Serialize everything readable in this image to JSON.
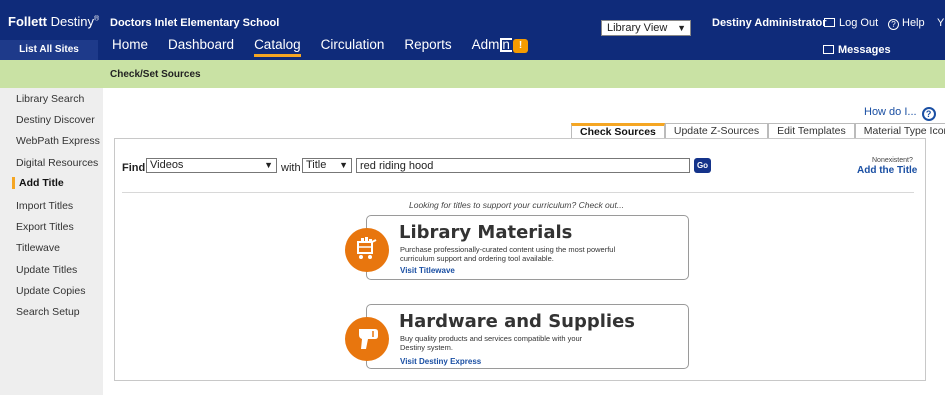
{
  "header": {
    "logo_bold": "Follett",
    "logo_light": "Destiny",
    "logo_mark": "®",
    "school_name": "Doctors Inlet Elementary School",
    "list_all_sites": "List All Sites",
    "view_select": "Library View",
    "user": "Destiny Administrator",
    "logout": "Log Out",
    "help": "Help",
    "help_overflow": "Y",
    "messages": "Messages",
    "alert_badge": "!",
    "nav": [
      {
        "label": "Home"
      },
      {
        "label": "Dashboard"
      },
      {
        "label": "Catalog",
        "active": true
      },
      {
        "label": "Circulation"
      },
      {
        "label": "Reports"
      },
      {
        "label": "Admin"
      }
    ]
  },
  "breadcrumb": "Check/Set Sources",
  "sidebar": {
    "items": [
      {
        "label": "Library Search"
      },
      {
        "label": "Destiny Discover"
      },
      {
        "label": "WebPath Express"
      },
      {
        "label": "Digital Resources"
      },
      {
        "label": "Add Title",
        "active": true
      },
      {
        "label": "Import Titles"
      },
      {
        "label": "Export Titles"
      },
      {
        "label": "Titlewave"
      },
      {
        "label": "Update Titles"
      },
      {
        "label": "Update Copies"
      },
      {
        "label": "Search Setup"
      }
    ]
  },
  "main": {
    "how_do_i": "How do I...",
    "help_mark": "?",
    "tabs": [
      {
        "label": "Check Sources",
        "active": true
      },
      {
        "label": "Update Z-Sources"
      },
      {
        "label": "Edit Templates"
      },
      {
        "label": "Material Type Icons"
      }
    ],
    "find": {
      "label": "Find",
      "type_value": "Videos",
      "with_label": "with",
      "field_value": "Title",
      "query": "red riding hood",
      "go": "Go"
    },
    "nonexistent": "Nonexistent?",
    "add_the_title": "Add the Title",
    "looking_text": "Looking for titles to support your curriculum? Check out...",
    "cards": [
      {
        "title": "Library Materials",
        "description": "Purchase professionally-curated content using the most powerful curriculum support and ordering tool available.",
        "link": "Visit Titlewave",
        "icon": "library-cart-icon"
      },
      {
        "title": "Hardware and Supplies",
        "description": "Buy quality products and services compatible with your Destiny system.",
        "link": "Visit Destiny Express",
        "icon": "barcode-scanner-icon"
      }
    ]
  },
  "colors": {
    "topbar": "#0f2b7a",
    "accent": "#f5a623",
    "breadcrumb_bg": "#c9e2a4",
    "sidebar_bg": "#eeeeee",
    "link": "#1a4fa3",
    "card_icon": "#e8760e"
  }
}
